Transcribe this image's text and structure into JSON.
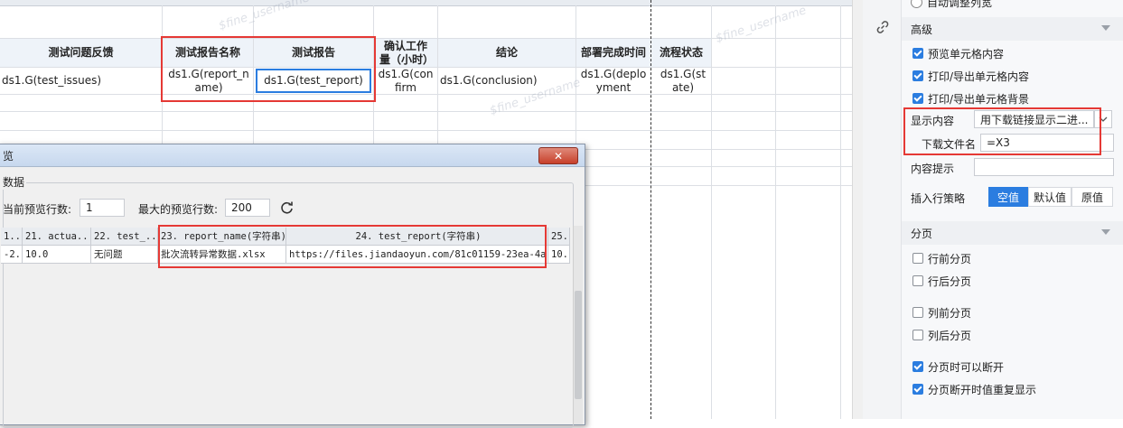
{
  "sheet": {
    "headers": {
      "issues": "测试问题反馈",
      "report_name": "测试报告名称",
      "report": "测试报告",
      "confirm": "确认工作量（小时）",
      "conclusion": "结论",
      "deploy": "部署完成时间",
      "state": "流程状态"
    },
    "cells": {
      "issues": "ds1.G(test_issues)",
      "report_name": "ds1.G(report_name)",
      "report": "ds1.G(test_report)",
      "confirm": "ds1.G(confirm",
      "conclusion": "ds1.G(conclusion)",
      "deploy": "ds1.G(deployment",
      "state": "ds1.G(state)"
    },
    "watermark": "$fine_username"
  },
  "panel": {
    "top_option": "自动调整列宽",
    "advanced": {
      "title": "高级",
      "preview_content": "预览单元格内容",
      "print_content": "打印/导出单元格内容",
      "print_bg": "打印/导出单元格背景",
      "display_label": "显示内容",
      "display_value": "用下载链接显示二进...",
      "filename_label": "下载文件名",
      "filename_value": "=X3",
      "tip_label": "内容提示",
      "insert_label": "插入行策略",
      "insert_options": [
        "空值",
        "默认值",
        "原值"
      ],
      "insert_selected": "空值"
    },
    "paging": {
      "title": "分页",
      "row_before": "行前分页",
      "row_after": "行后分页",
      "col_before": "列前分页",
      "col_after": "列后分页",
      "can_break": "分页时可以断开",
      "repeat_on_break": "分页断开时值重复显示"
    }
  },
  "dialog": {
    "title": "览",
    "close_label": "✕",
    "group_title": "数据",
    "current_rows_label": "当前预览行数:",
    "current_rows_value": "1",
    "max_rows_label": "最大的预览行数:",
    "max_rows_value": "200",
    "columns": [
      "1...",
      "21. actua...",
      "22. test_...",
      "23. report_name(字符串)",
      "24. test_report(字符串)",
      "25."
    ],
    "row": [
      "-2...",
      "10.0",
      "无问题",
      "批次流转异常数据.xlsx",
      "https://files.jiandaoyun.com/81c01159-23ea-4a...",
      "10."
    ]
  },
  "colors": {
    "accent": "#2b7de0",
    "highlight": "#e53935",
    "header_bg": "#eef3f9"
  }
}
